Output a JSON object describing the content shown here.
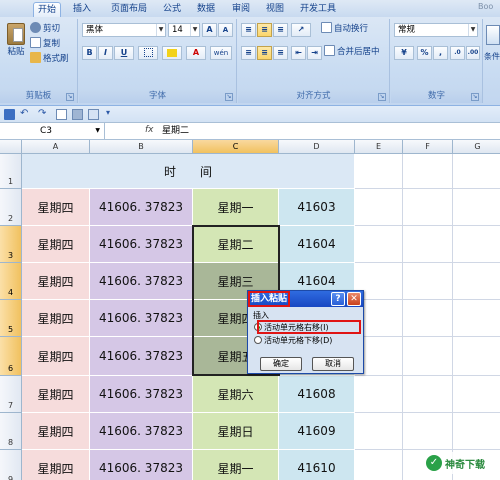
{
  "window": {
    "title_fragment": "Boo"
  },
  "ribbon_tabs": [
    {
      "label": "开始",
      "active": true
    },
    {
      "label": "插入",
      "active": false
    },
    {
      "label": "页面布局",
      "active": false
    },
    {
      "label": "公式",
      "active": false
    },
    {
      "label": "数据",
      "active": false
    },
    {
      "label": "审阅",
      "active": false
    },
    {
      "label": "视图",
      "active": false
    },
    {
      "label": "开发工具",
      "active": false
    }
  ],
  "clipboard": {
    "paste": "粘贴",
    "cut": "剪切",
    "copy": "复制",
    "format_painter": "格式刷",
    "group_label": "剪贴板"
  },
  "font": {
    "name": "黑体",
    "size": "14",
    "bold": "B",
    "italic": "I",
    "underline": "U",
    "grow": "A",
    "shrink": "A",
    "color_letter": "A",
    "phonetic": "wén",
    "group_label": "字体"
  },
  "alignment": {
    "wrap_text": "自动换行",
    "merge_center": "合并后居中",
    "group_label": "对齐方式"
  },
  "number": {
    "format": "常规",
    "percent": "%",
    "comma": ",",
    "dec_inc": ".0",
    "dec_dec": ".00",
    "group_label": "数字"
  },
  "styles": {
    "conditional": "条件"
  },
  "formula_bar": {
    "cell_ref": "C3",
    "fx": "fx",
    "content": "星期二"
  },
  "columns": [
    "A",
    "B",
    "C",
    "D",
    "E",
    "F",
    "G"
  ],
  "rows": [
    {
      "num": "1",
      "a": "",
      "b": "时",
      "c": "间",
      "d": ""
    },
    {
      "num": "2",
      "a": "星期四",
      "b": "41606. 37823",
      "c": "星期一",
      "d": "41603"
    },
    {
      "num": "3",
      "a": "星期四",
      "b": "41606. 37823",
      "c": "星期二",
      "d": "41604"
    },
    {
      "num": "4",
      "a": "星期四",
      "b": "41606. 37823",
      "c": "星期三",
      "d": "41604"
    },
    {
      "num": "5",
      "a": "星期四",
      "b": "41606. 37823",
      "c": "星期四",
      "d": ""
    },
    {
      "num": "6",
      "a": "星期四",
      "b": "41606. 37823",
      "c": "星期五",
      "d": ""
    },
    {
      "num": "7",
      "a": "星期四",
      "b": "41606. 37823",
      "c": "星期六",
      "d": "41608"
    },
    {
      "num": "8",
      "a": "星期四",
      "b": "41606. 37823",
      "c": "星期日",
      "d": "41609"
    },
    {
      "num": "9",
      "a": "星期四",
      "b": "41606. 37823",
      "c": "星期一",
      "d": "41610"
    }
  ],
  "dialog": {
    "title": "插入粘贴",
    "section": "插入",
    "option1": "活动单元格右移(I)",
    "option2": "活动单元格下移(D)",
    "ok": "确定",
    "cancel": "取消",
    "selected": "option1"
  },
  "watermark": {
    "text": "神奇下载"
  },
  "colors": {
    "col_a": "#f6dcdc",
    "col_b": "#d5c7e6",
    "col_c": "#d4e6b5",
    "col_d": "#cde6f0",
    "header": "#dbe8f5",
    "highlight": "#e01414"
  }
}
